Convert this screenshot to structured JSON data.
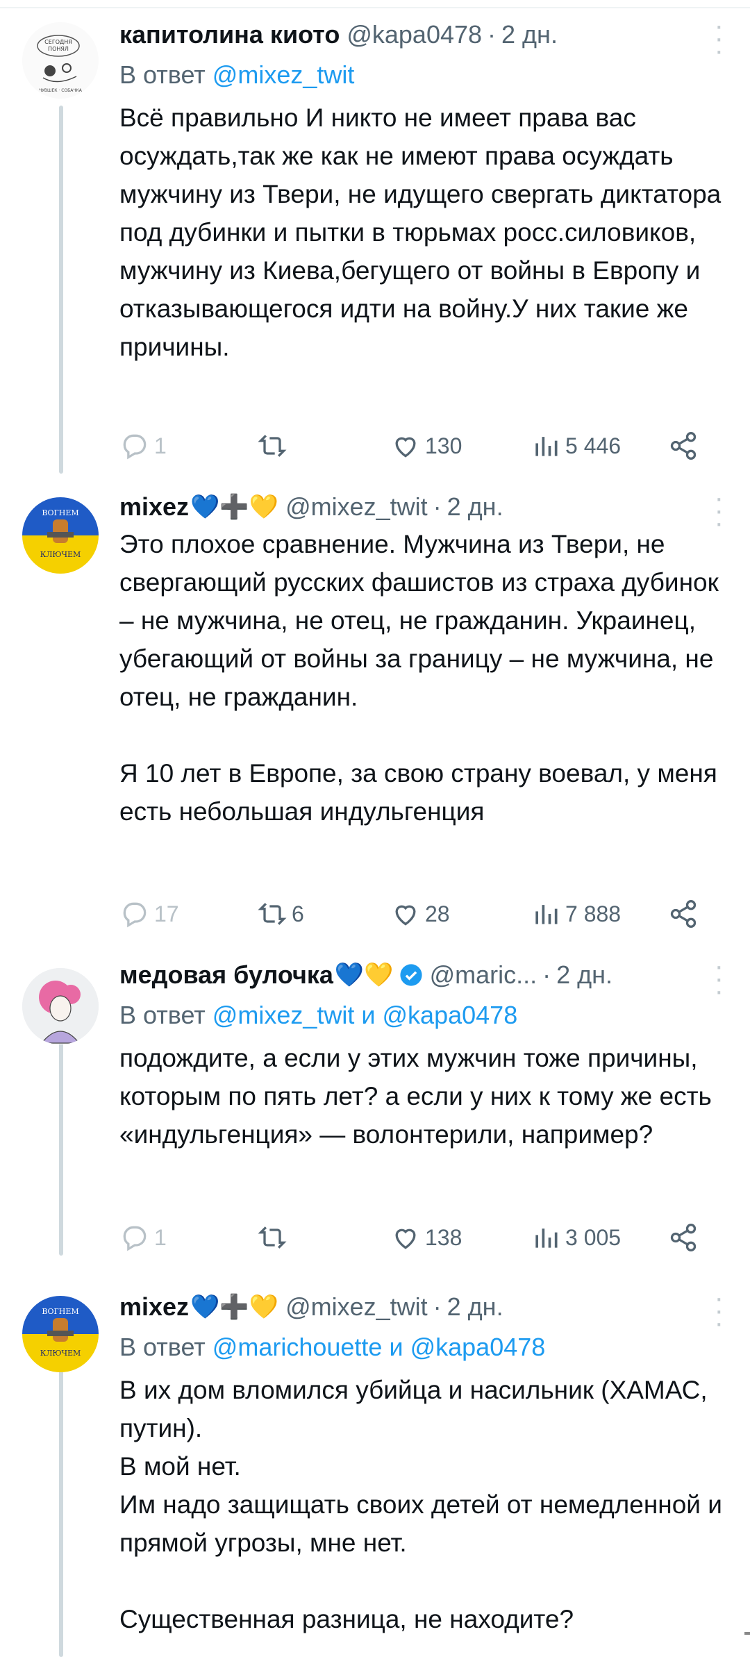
{
  "tweets": [
    {
      "name": "капитолина киото",
      "emoji": "",
      "handle": "@kapa0478",
      "time": "2 дн.",
      "reply_prefix": "В ответ",
      "reply_mentions": "@mixez_twit",
      "reply_and": "",
      "reply_mention2": "",
      "text": "Всё правильно И никто не имеет права вас осуждать,так же как не имеют права осуждать мужчину из Твери, не идущего свергать диктатора под дубинки и пытки в тюрьмах росс.силовиков, мужчину из Киева,бегущего от войны в Европу и отказывающегося идти на войну.У них такие же причины.",
      "replies": "1",
      "retweets": "",
      "likes": "130",
      "views": "5 446"
    },
    {
      "name": "mixez",
      "emoji": "💙➕💛",
      "handle": "@mixez_twit",
      "time": "2 дн.",
      "reply_prefix": "",
      "reply_mentions": "",
      "reply_and": "",
      "reply_mention2": "",
      "text": "Это плохое сравнение. Мужчина из Твери, не свергающий русских фашистов из страха дубинок – не мужчина, не отец, не гражданин. Украинец, убегающий от войны за границу – не мужчина, не отец, не гражданин.\n\nЯ 10 лет в Европе, за свою страну воевал, у меня есть небольшая индульгенция",
      "replies": "17",
      "retweets": "6",
      "likes": "28",
      "views": "7 888"
    },
    {
      "name": "медовая булочка",
      "emoji": "💙💛",
      "handle": "@maric...",
      "time": "2 дн.",
      "reply_prefix": "В ответ",
      "reply_mentions": "@mixez_twit",
      "reply_and": "и",
      "reply_mention2": "@kapa0478",
      "text": "подождите, а если у этих мужчин тоже причины, которым по пять лет? а если у них к тому же есть «индульгенция» — волонтерили, например?",
      "replies": "1",
      "retweets": "",
      "likes": "138",
      "views": "3 005"
    },
    {
      "name": "mixez",
      "emoji": "💙➕💛",
      "handle": "@mixez_twit",
      "time": "2 дн.",
      "reply_prefix": "В ответ",
      "reply_mentions": "@marichouette",
      "reply_and": "и",
      "reply_mention2": "@kapa0478",
      "text": "В их дом вломился убийца и насильник (ХАМАС, путин).\nВ мой нет.\nИм надо защищать своих детей от немедленной и прямой угрозы, мне нет.\n\nСущественная разница, не находите?",
      "replies": "",
      "retweets": "",
      "likes": "",
      "views": ""
    }
  ],
  "avatar_texts": {
    "mixez_top": "ВОГНЕМ",
    "mixez_bottom": "КЛЮЧЕМ"
  },
  "colors": {
    "link": "#1d9bf0",
    "muted": "#536471",
    "thread_line": "#cfd9de",
    "ukraine_blue": "#1f5bc6",
    "ukraine_yellow": "#f5d000"
  },
  "icons": [
    "reply-icon",
    "retweet-icon",
    "like-icon",
    "views-icon",
    "share-icon",
    "more-icon",
    "verified-icon"
  ]
}
